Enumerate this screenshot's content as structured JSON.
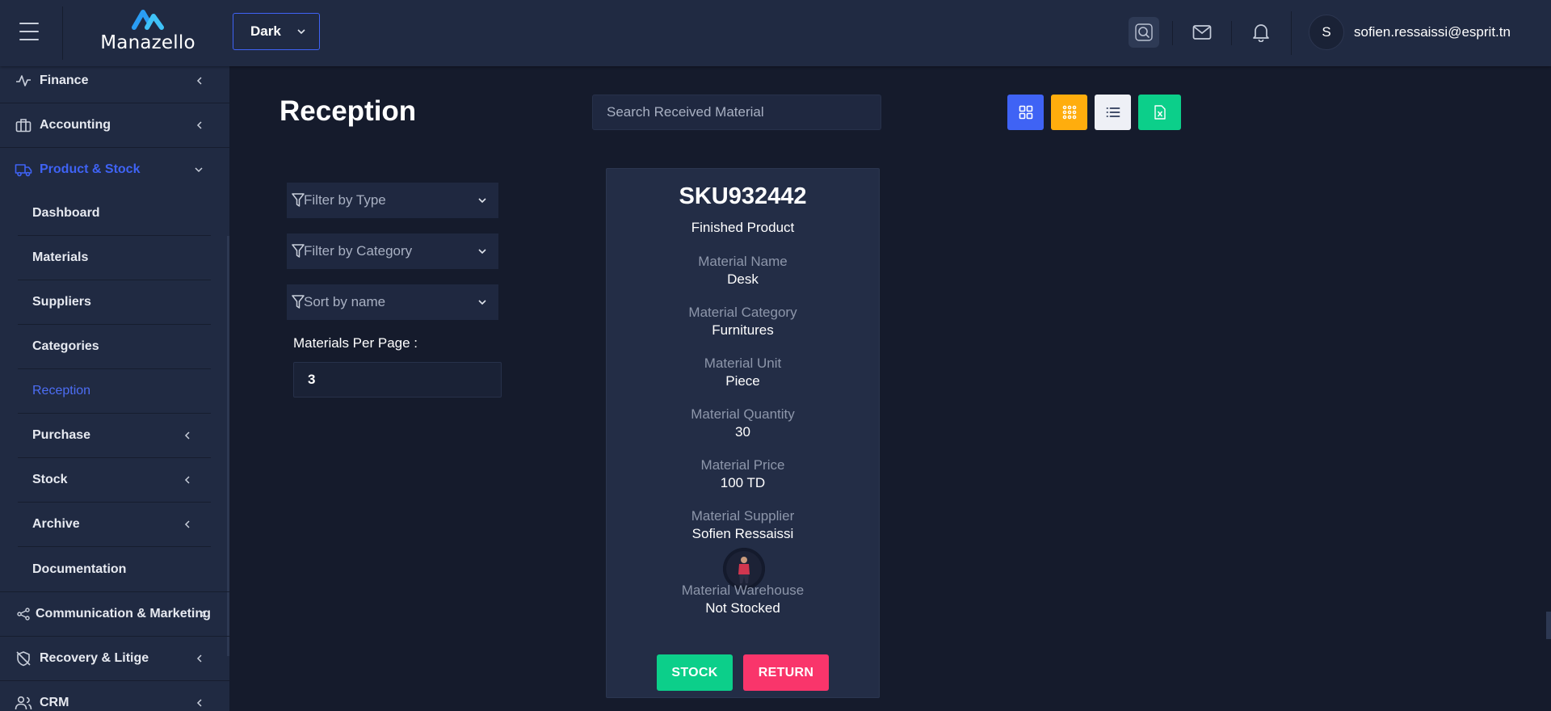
{
  "app": {
    "logo_text": "Manazello",
    "theme_label": "Dark",
    "user_initial": "S",
    "user_email": "sofien.ressaissi@esprit.tn"
  },
  "sidebar": {
    "finance": "Finance",
    "accounting": "Accounting",
    "product_stock": "Product & Stock",
    "sub": {
      "dashboard": "Dashboard",
      "materials": "Materials",
      "suppliers": "Suppliers",
      "categories": "Categories",
      "reception": "Reception",
      "purchase": "Purchase",
      "stock": "Stock",
      "archive": "Archive",
      "documentation": "Documentation"
    },
    "communication": "Communication & Marketing",
    "recovery": "Recovery & Litige",
    "crm": "CRM"
  },
  "main": {
    "title": "Reception",
    "search_placeholder": "Search Received Material",
    "filters": {
      "type": "Filter by Type",
      "category": "Filter by Category",
      "sort": "Sort by name"
    },
    "per_page_label": "Materials Per Page :",
    "per_page_value": "3"
  },
  "card": {
    "sku": "SKU932442",
    "product_type": "Finished Product",
    "fields": {
      "name_label": "Material Name",
      "name_value": "Desk",
      "category_label": "Material Category",
      "category_value": "Furnitures",
      "unit_label": "Material Unit",
      "unit_value": "Piece",
      "quantity_label": "Material Quantity",
      "quantity_value": "30",
      "price_label": "Material Price",
      "price_value": "100 TD",
      "supplier_label": "Material Supplier",
      "supplier_value": "Sofien Ressaissi",
      "warehouse_label": "Material Warehouse",
      "warehouse_value": "Not Stocked"
    },
    "stock_button": "STOCK",
    "return_button": "RETURN"
  },
  "colors": {
    "accent_blue": "#3f63f5",
    "view_yellow": "#ffad0d",
    "excel_green": "#0ccf8a",
    "return_pink": "#f9356b"
  }
}
